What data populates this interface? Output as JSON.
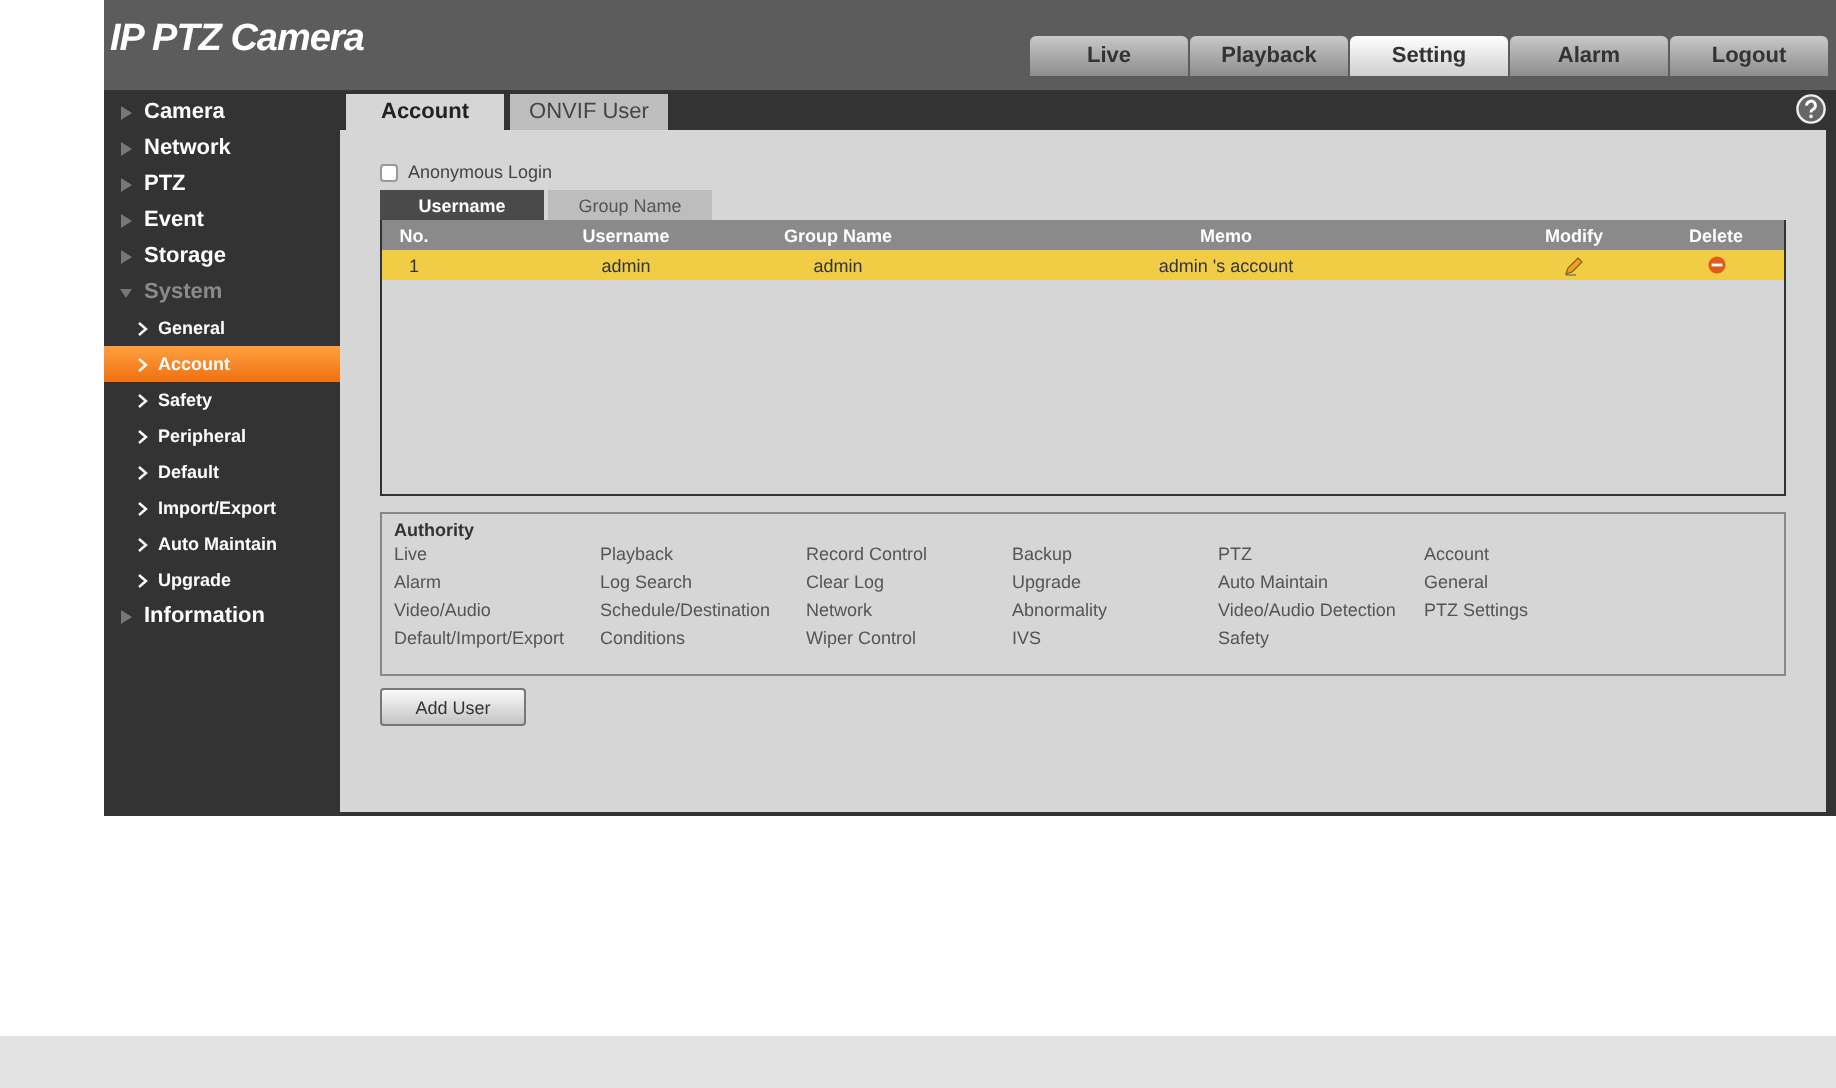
{
  "header": {
    "title": "IP PTZ Camera",
    "nav_tabs": [
      {
        "label": "Live",
        "selected": false
      },
      {
        "label": "Playback",
        "selected": false
      },
      {
        "label": "Setting",
        "selected": true
      },
      {
        "label": "Alarm",
        "selected": false
      },
      {
        "label": "Logout",
        "selected": false
      }
    ]
  },
  "sidebar": {
    "items": [
      {
        "label": "Camera",
        "expanded": false
      },
      {
        "label": "Network",
        "expanded": false
      },
      {
        "label": "PTZ",
        "expanded": false
      },
      {
        "label": "Event",
        "expanded": false
      },
      {
        "label": "Storage",
        "expanded": false
      },
      {
        "label": "System",
        "expanded": true,
        "children": [
          {
            "label": "General",
            "selected": false
          },
          {
            "label": "Account",
            "selected": true
          },
          {
            "label": "Safety",
            "selected": false
          },
          {
            "label": "Peripheral",
            "selected": false
          },
          {
            "label": "Default",
            "selected": false
          },
          {
            "label": "Import/Export",
            "selected": false
          },
          {
            "label": "Auto Maintain",
            "selected": false
          },
          {
            "label": "Upgrade",
            "selected": false
          }
        ]
      },
      {
        "label": "Information",
        "expanded": false
      }
    ]
  },
  "content": {
    "tabs": [
      {
        "label": "Account",
        "selected": true
      },
      {
        "label": "ONVIF User",
        "selected": false
      }
    ],
    "anonymous_login": {
      "label": "Anonymous Login",
      "checked": false
    },
    "sub_tabs": [
      {
        "label": "Username",
        "selected": true
      },
      {
        "label": "Group Name",
        "selected": false
      }
    ],
    "table": {
      "columns": [
        "No.",
        "Username",
        "Group Name",
        "Memo",
        "Modify",
        "Delete"
      ],
      "rows": [
        {
          "cells": [
            "1",
            "admin",
            "admin",
            "admin 's account"
          ],
          "selected": true
        }
      ]
    },
    "authority": {
      "title": "Authority",
      "items": [
        "Live",
        "Playback",
        "Record Control",
        "Backup",
        "PTZ",
        "Account",
        "Alarm",
        "Log Search",
        "Clear Log",
        "Upgrade",
        "Auto Maintain",
        "General",
        "Video/Audio",
        "Schedule/Destination",
        "Network",
        "Abnormality",
        "Video/Audio Detection",
        "PTZ Settings",
        "Default/Import/Export",
        "Conditions",
        "Wiper Control",
        "IVS",
        "Safety"
      ]
    },
    "add_user_button": "Add User"
  }
}
